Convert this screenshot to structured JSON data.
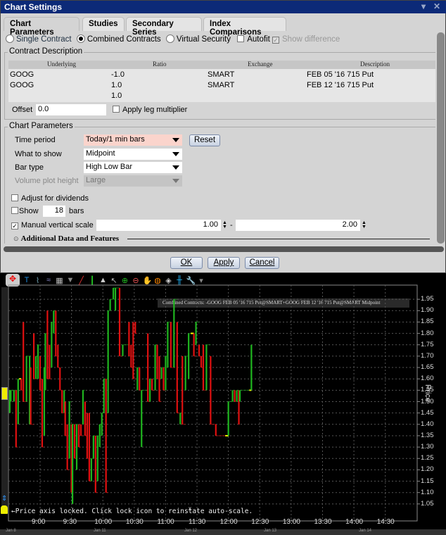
{
  "dialog": {
    "title": "Chart Settings",
    "tabs": [
      "Chart Parameters",
      "Studies",
      "Secondary Series",
      "Index Comparisons"
    ],
    "mode": {
      "options": [
        "Single Contract",
        "Combined Contracts",
        "Virtual Security"
      ],
      "selected": "Combined Contracts",
      "autofit_label": "Autofit",
      "autofit": false,
      "show_difference_label": "Show difference",
      "show_difference": true
    },
    "contract_description": {
      "legend": "Contract Description",
      "columns": [
        "Underlying",
        "Ratio",
        "Exchange",
        "Description"
      ],
      "rows": [
        [
          "GOOG",
          "-1.0",
          "SMART",
          "FEB 05 '16 715 Put"
        ],
        [
          "GOOG",
          "1.0",
          "SMART",
          "FEB 12 '16 715 Put"
        ],
        [
          "",
          "1.0",
          "",
          ""
        ]
      ],
      "offset_label": "Offset",
      "offset_value": "0.0",
      "apply_leg_multiplier_label": "Apply leg multiplier",
      "apply_leg_multiplier": false
    },
    "chart_parameters": {
      "legend": "Chart Parameters",
      "time_period_label": "Time period",
      "time_period": "Today/1 min bars",
      "reset_label": "Reset",
      "what_to_show_label": "What to show",
      "what_to_show": "Midpoint",
      "bar_type_label": "Bar type",
      "bar_type": "High Low Bar",
      "volume_plot_height_label": "Volume plot height",
      "volume_plot_height": "Large",
      "adjust_dividends_label": "Adjust for dividends",
      "adjust_dividends": false,
      "show_label": "Show",
      "show_bars_value": "18",
      "bars_label": "bars",
      "show_bars": false,
      "manual_scale_label": "Manual vertical scale",
      "manual_scale": true,
      "scale_min": "1.00",
      "scale_sep": "-",
      "scale_max": "2.00",
      "additional_label": "Additional Data and Features"
    },
    "buttons": {
      "ok": "OK",
      "apply": "Apply",
      "cancel": "Cancel"
    }
  },
  "chart": {
    "legend_text": "Combined Contracts: -GOOG FEB 05 '16 715 Put@SMART+GOOG FEB 12 '16 715 Put@SMART Midpoint",
    "lock_message": "Price axis locked. Click lock icon to reinstate auto-scale.",
    "lock_close": "x",
    "axis_label": "Price",
    "date_labels": [
      "Jan 8",
      "Jan 11",
      "Jan 12",
      "Jan 13",
      "Jan 14"
    ],
    "colors": {
      "up": "#1fb51f",
      "down": "#e01010",
      "flat": "#ffff00",
      "background": "#000000"
    },
    "toolbar_icons": [
      "crosshair-icon",
      "text-icon",
      "add-study-icon",
      "chart-compare-icon",
      "grid-layout-icon",
      "dropdown-icon",
      "draw-line-icon",
      "bar-type-icon",
      "volume-icon",
      "cursor-icon",
      "zoom-in-icon",
      "zoom-out-icon",
      "pan-hand-icon",
      "globe-icon",
      "split-icon",
      "separator-icon",
      "wrench-icon",
      "more-icon"
    ]
  },
  "chart_data": {
    "type": "bar",
    "bar_type": "high-low",
    "ylim": [
      1.0,
      2.0
    ],
    "ylabel": "Price",
    "y_ticks": [
      "1.05",
      "1.10",
      "1.15",
      "1.20",
      "1.25",
      "1.30",
      "1.35",
      "1.40",
      "1.45",
      "1.50",
      "1.55",
      "1.60",
      "1.65",
      "1.70",
      "1.75",
      "1.80",
      "1.85",
      "1.90",
      "1.95"
    ],
    "x_ticks": [
      "9:00",
      "9:30",
      "10:00",
      "10:30",
      "11:00",
      "11:30",
      "12:00",
      "12:30",
      "13:00",
      "13:30",
      "14:00",
      "14:30"
    ],
    "grid": true,
    "bars": [
      [
        "8:31",
        1.45,
        1.55,
        "up"
      ],
      [
        "8:32",
        1.5,
        1.55,
        "up"
      ],
      [
        "8:35",
        1.5,
        1.55,
        "up"
      ],
      [
        "8:37",
        1.3,
        1.55,
        "down"
      ],
      [
        "8:39",
        1.4,
        1.6,
        "up"
      ],
      [
        "8:40",
        1.6,
        1.6,
        "flat"
      ],
      [
        "8:42",
        1.55,
        1.6,
        "down"
      ],
      [
        "8:44",
        1.5,
        1.85,
        "down"
      ],
      [
        "8:47",
        1.5,
        1.7,
        "up"
      ],
      [
        "8:50",
        1.4,
        1.7,
        "up"
      ],
      [
        "8:51",
        1.4,
        1.65,
        "down"
      ],
      [
        "8:54",
        1.6,
        1.8,
        "down"
      ],
      [
        "8:56",
        1.6,
        1.7,
        "up"
      ],
      [
        "8:58",
        1.6,
        1.75,
        "up"
      ],
      [
        "9:00",
        1.55,
        1.7,
        "down"
      ],
      [
        "9:02",
        1.3,
        1.6,
        "down"
      ],
      [
        "9:04",
        1.35,
        1.65,
        "up"
      ],
      [
        "9:05",
        1.55,
        1.8,
        "up"
      ],
      [
        "9:07",
        1.6,
        1.9,
        "down"
      ],
      [
        "9:09",
        1.6,
        1.75,
        "down"
      ],
      [
        "9:11",
        1.65,
        1.85,
        "up"
      ],
      [
        "9:13",
        1.8,
        1.9,
        "up"
      ],
      [
        "9:15",
        1.7,
        1.9,
        "down"
      ],
      [
        "9:17",
        1.65,
        1.75,
        "down"
      ],
      [
        "9:19",
        1.55,
        1.65,
        "down"
      ],
      [
        "9:21",
        1.45,
        1.55,
        "down"
      ],
      [
        "9:23",
        1.45,
        1.55,
        "up"
      ],
      [
        "9:24",
        1.35,
        1.5,
        "down"
      ],
      [
        "9:26",
        1.2,
        1.4,
        "down"
      ],
      [
        "9:28",
        1.25,
        1.5,
        "up"
      ],
      [
        "9:30",
        1.1,
        1.4,
        "down"
      ],
      [
        "9:31",
        1.05,
        1.4,
        "up"
      ],
      [
        "9:33",
        1.25,
        1.4,
        "down"
      ],
      [
        "9:35",
        1.2,
        1.4,
        "up"
      ],
      [
        "9:37",
        1.3,
        1.4,
        "down"
      ],
      [
        "9:39",
        1.35,
        1.4,
        "down"
      ],
      [
        "9:41",
        1.4,
        1.55,
        "up"
      ],
      [
        "9:43",
        1.35,
        1.5,
        "down"
      ],
      [
        "9:45",
        1.25,
        1.45,
        "down"
      ],
      [
        "9:47",
        1.15,
        1.45,
        "down"
      ],
      [
        "9:49",
        1.15,
        1.25,
        "up"
      ],
      [
        "9:51",
        1.25,
        1.35,
        "up"
      ],
      [
        "9:53",
        1.1,
        1.35,
        "down"
      ],
      [
        "9:55",
        1.15,
        1.35,
        "up"
      ],
      [
        "9:57",
        1.3,
        1.4,
        "up"
      ],
      [
        "9:59",
        1.35,
        1.45,
        "up"
      ],
      [
        "10:01",
        1.45,
        1.6,
        "up"
      ],
      [
        "10:03",
        1.1,
        1.6,
        "down"
      ],
      [
        "10:05",
        1.45,
        1.9,
        "up"
      ],
      [
        "10:07",
        1.9,
        1.95,
        "up"
      ],
      [
        "10:10",
        1.95,
        2.0,
        "up"
      ],
      [
        "10:12",
        1.9,
        2.0,
        "up"
      ],
      [
        "10:16",
        1.7,
        2.0,
        "down"
      ],
      [
        "10:19",
        1.7,
        1.75,
        "up"
      ],
      [
        "10:25",
        1.7,
        1.85,
        "down"
      ],
      [
        "10:27",
        1.65,
        1.75,
        "down"
      ],
      [
        "10:29",
        1.6,
        1.85,
        "down"
      ],
      [
        "10:31",
        1.8,
        1.85,
        "down"
      ],
      [
        "10:33",
        1.55,
        1.65,
        "up"
      ],
      [
        "10:35",
        1.55,
        1.65,
        "down"
      ],
      [
        "10:37",
        1.3,
        1.55,
        "up"
      ],
      [
        "10:43",
        1.5,
        1.8,
        "down"
      ],
      [
        "10:45",
        1.5,
        1.6,
        "up"
      ],
      [
        "10:47",
        1.55,
        1.6,
        "down"
      ],
      [
        "10:50",
        1.55,
        1.75,
        "up"
      ],
      [
        "10:52",
        1.6,
        1.75,
        "down"
      ],
      [
        "10:54",
        1.5,
        1.7,
        "down"
      ],
      [
        "10:56",
        1.6,
        1.65,
        "up"
      ],
      [
        "10:58",
        1.55,
        1.65,
        "down"
      ],
      [
        "11:00",
        1.55,
        1.7,
        "up"
      ],
      [
        "11:02",
        1.65,
        1.85,
        "up"
      ],
      [
        "11:05",
        1.65,
        1.85,
        "down"
      ],
      [
        "11:08",
        1.65,
        1.95,
        "up"
      ],
      [
        "11:11",
        1.45,
        1.85,
        "down"
      ],
      [
        "11:14",
        1.4,
        1.45,
        "up"
      ],
      [
        "11:16",
        1.4,
        1.7,
        "down"
      ],
      [
        "11:19",
        1.55,
        1.7,
        "up"
      ],
      [
        "11:22",
        1.6,
        1.8,
        "up"
      ],
      [
        "11:24",
        1.8,
        1.8,
        "flat"
      ],
      [
        "11:27",
        1.7,
        1.8,
        "down"
      ],
      [
        "11:29",
        1.75,
        1.85,
        "up"
      ],
      [
        "11:32",
        1.7,
        1.75,
        "down"
      ],
      [
        "11:34",
        1.65,
        1.7,
        "down"
      ],
      [
        "11:36",
        1.55,
        1.75,
        "down"
      ],
      [
        "11:39",
        1.55,
        1.75,
        "up"
      ],
      [
        "11:43",
        1.4,
        1.7,
        "down"
      ],
      [
        "11:48",
        1.35,
        1.4,
        "down"
      ],
      [
        "11:57",
        1.35,
        1.35,
        "flat"
      ],
      [
        "12:00",
        1.35,
        1.5,
        "up"
      ],
      [
        "12:04",
        1.5,
        1.55,
        "up"
      ],
      [
        "12:06",
        1.5,
        1.55,
        "down"
      ],
      [
        "12:08",
        1.5,
        1.55,
        "up"
      ],
      [
        "12:10",
        1.4,
        1.55,
        "down"
      ],
      [
        "12:11",
        1.5,
        1.55,
        "up"
      ],
      [
        "12:20",
        1.55,
        1.55,
        "flat"
      ],
      [
        "12:22",
        1.55,
        1.75,
        "up"
      ]
    ]
  }
}
